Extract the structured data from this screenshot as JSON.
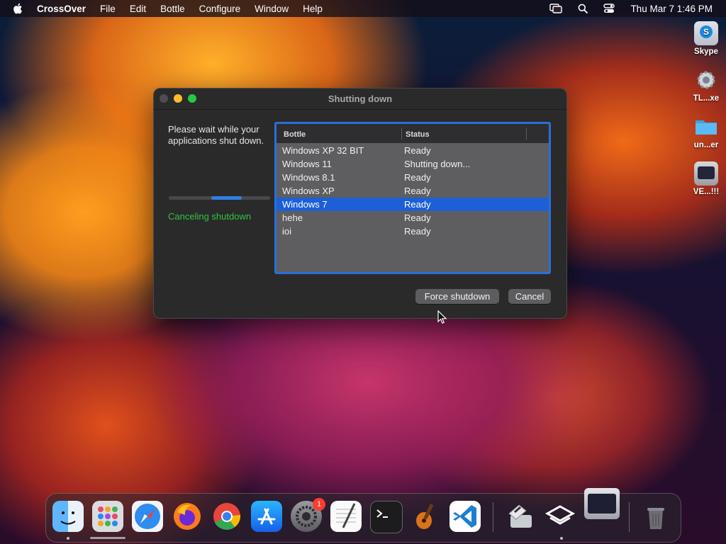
{
  "menubar": {
    "app_name": "CrossOver",
    "menus": [
      "File",
      "Edit",
      "Bottle",
      "Configure",
      "Window",
      "Help"
    ],
    "datetime": "Thu Mar 7  1:46 PM"
  },
  "desktop_icons": [
    {
      "label": "Skype",
      "icon": "skype-icon"
    },
    {
      "label": "TL...xe",
      "icon": "gear-exe-icon"
    },
    {
      "label": "un...er",
      "icon": "folder-icon"
    },
    {
      "label": "VE...!!!",
      "icon": "video-app-icon"
    }
  ],
  "dialog": {
    "title": "Shutting down",
    "message": "Please wait while your applications shut down.",
    "progress_fraction": 0.3,
    "cancel_status": "Canceling shutdown",
    "columns": [
      "Bottle",
      "Status"
    ],
    "rows": [
      {
        "bottle": "Windows XP 32 BIT",
        "status": "Ready",
        "selected": false
      },
      {
        "bottle": "Windows 11",
        "status": "Shutting down...",
        "selected": false
      },
      {
        "bottle": "Windows 8.1",
        "status": "Ready",
        "selected": false
      },
      {
        "bottle": "Windows XP",
        "status": "Ready",
        "selected": false
      },
      {
        "bottle": "Windows 7",
        "status": "Ready",
        "selected": true
      },
      {
        "bottle": "hehe",
        "status": "Ready",
        "selected": false
      },
      {
        "bottle": "ioi",
        "status": "Ready",
        "selected": false
      }
    ],
    "force_button": "Force shutdown",
    "cancel_button": "Cancel"
  },
  "dock": {
    "items": [
      "finder-icon",
      "launchpad-icon",
      "safari-icon",
      "firefox-icon",
      "chrome-icon",
      "app-store-icon",
      "system-settings-icon",
      "textedit-icon",
      "terminal-icon",
      "garageband-icon",
      "vscode-icon",
      "crossover-icon",
      "bottle-layers-icon",
      "video-window-icon",
      "trash-icon"
    ],
    "system_settings_badge": "1"
  },
  "colors": {
    "accent": "#1d5fd6",
    "status_green": "#31c33f",
    "window_bg": "#2a2a2b"
  }
}
